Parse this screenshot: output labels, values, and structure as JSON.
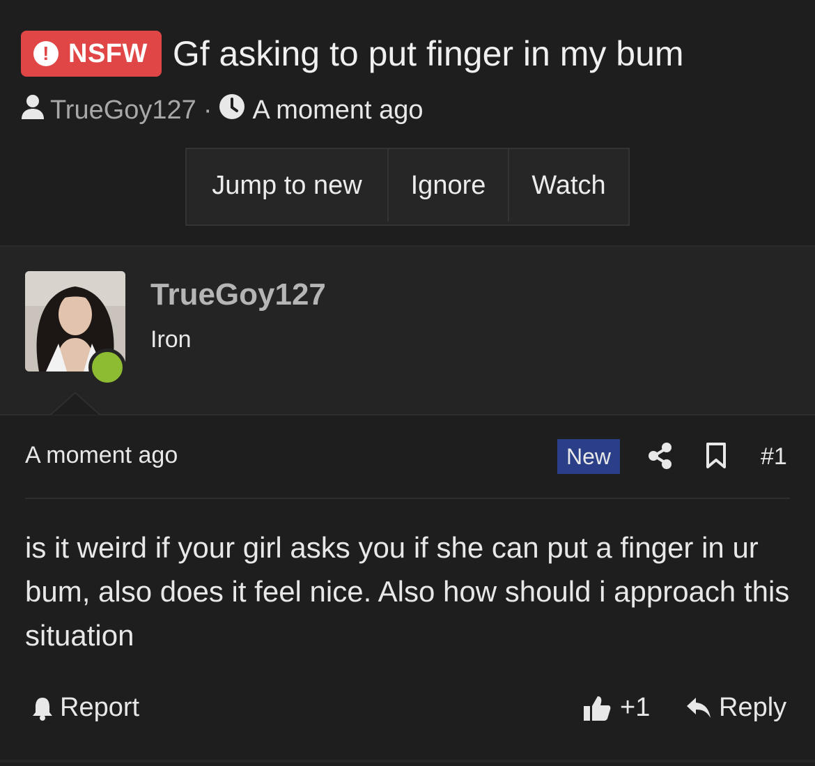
{
  "thread": {
    "badge": "NSFW",
    "title": "Gf asking to put finger in my bum",
    "author": "TrueGoy127",
    "separator": "·",
    "time": "A moment ago"
  },
  "actions": {
    "jump": "Jump to new",
    "ignore": "Ignore",
    "watch": "Watch"
  },
  "post": {
    "username": "TrueGoy127",
    "user_title": "Iron",
    "time": "A moment ago",
    "badge": "New",
    "number": "#1",
    "message": "is it weird if your girl asks you if she can put a finger in ur bum, also does it feel nice. Also how should i approach this situation",
    "report": "Report",
    "reaction_count": "+1",
    "reply": "Reply"
  },
  "colors": {
    "background": "#1e1e1e",
    "nsfw": "#e04646",
    "new_badge": "#2b3f89",
    "online": "#8dbb31"
  }
}
